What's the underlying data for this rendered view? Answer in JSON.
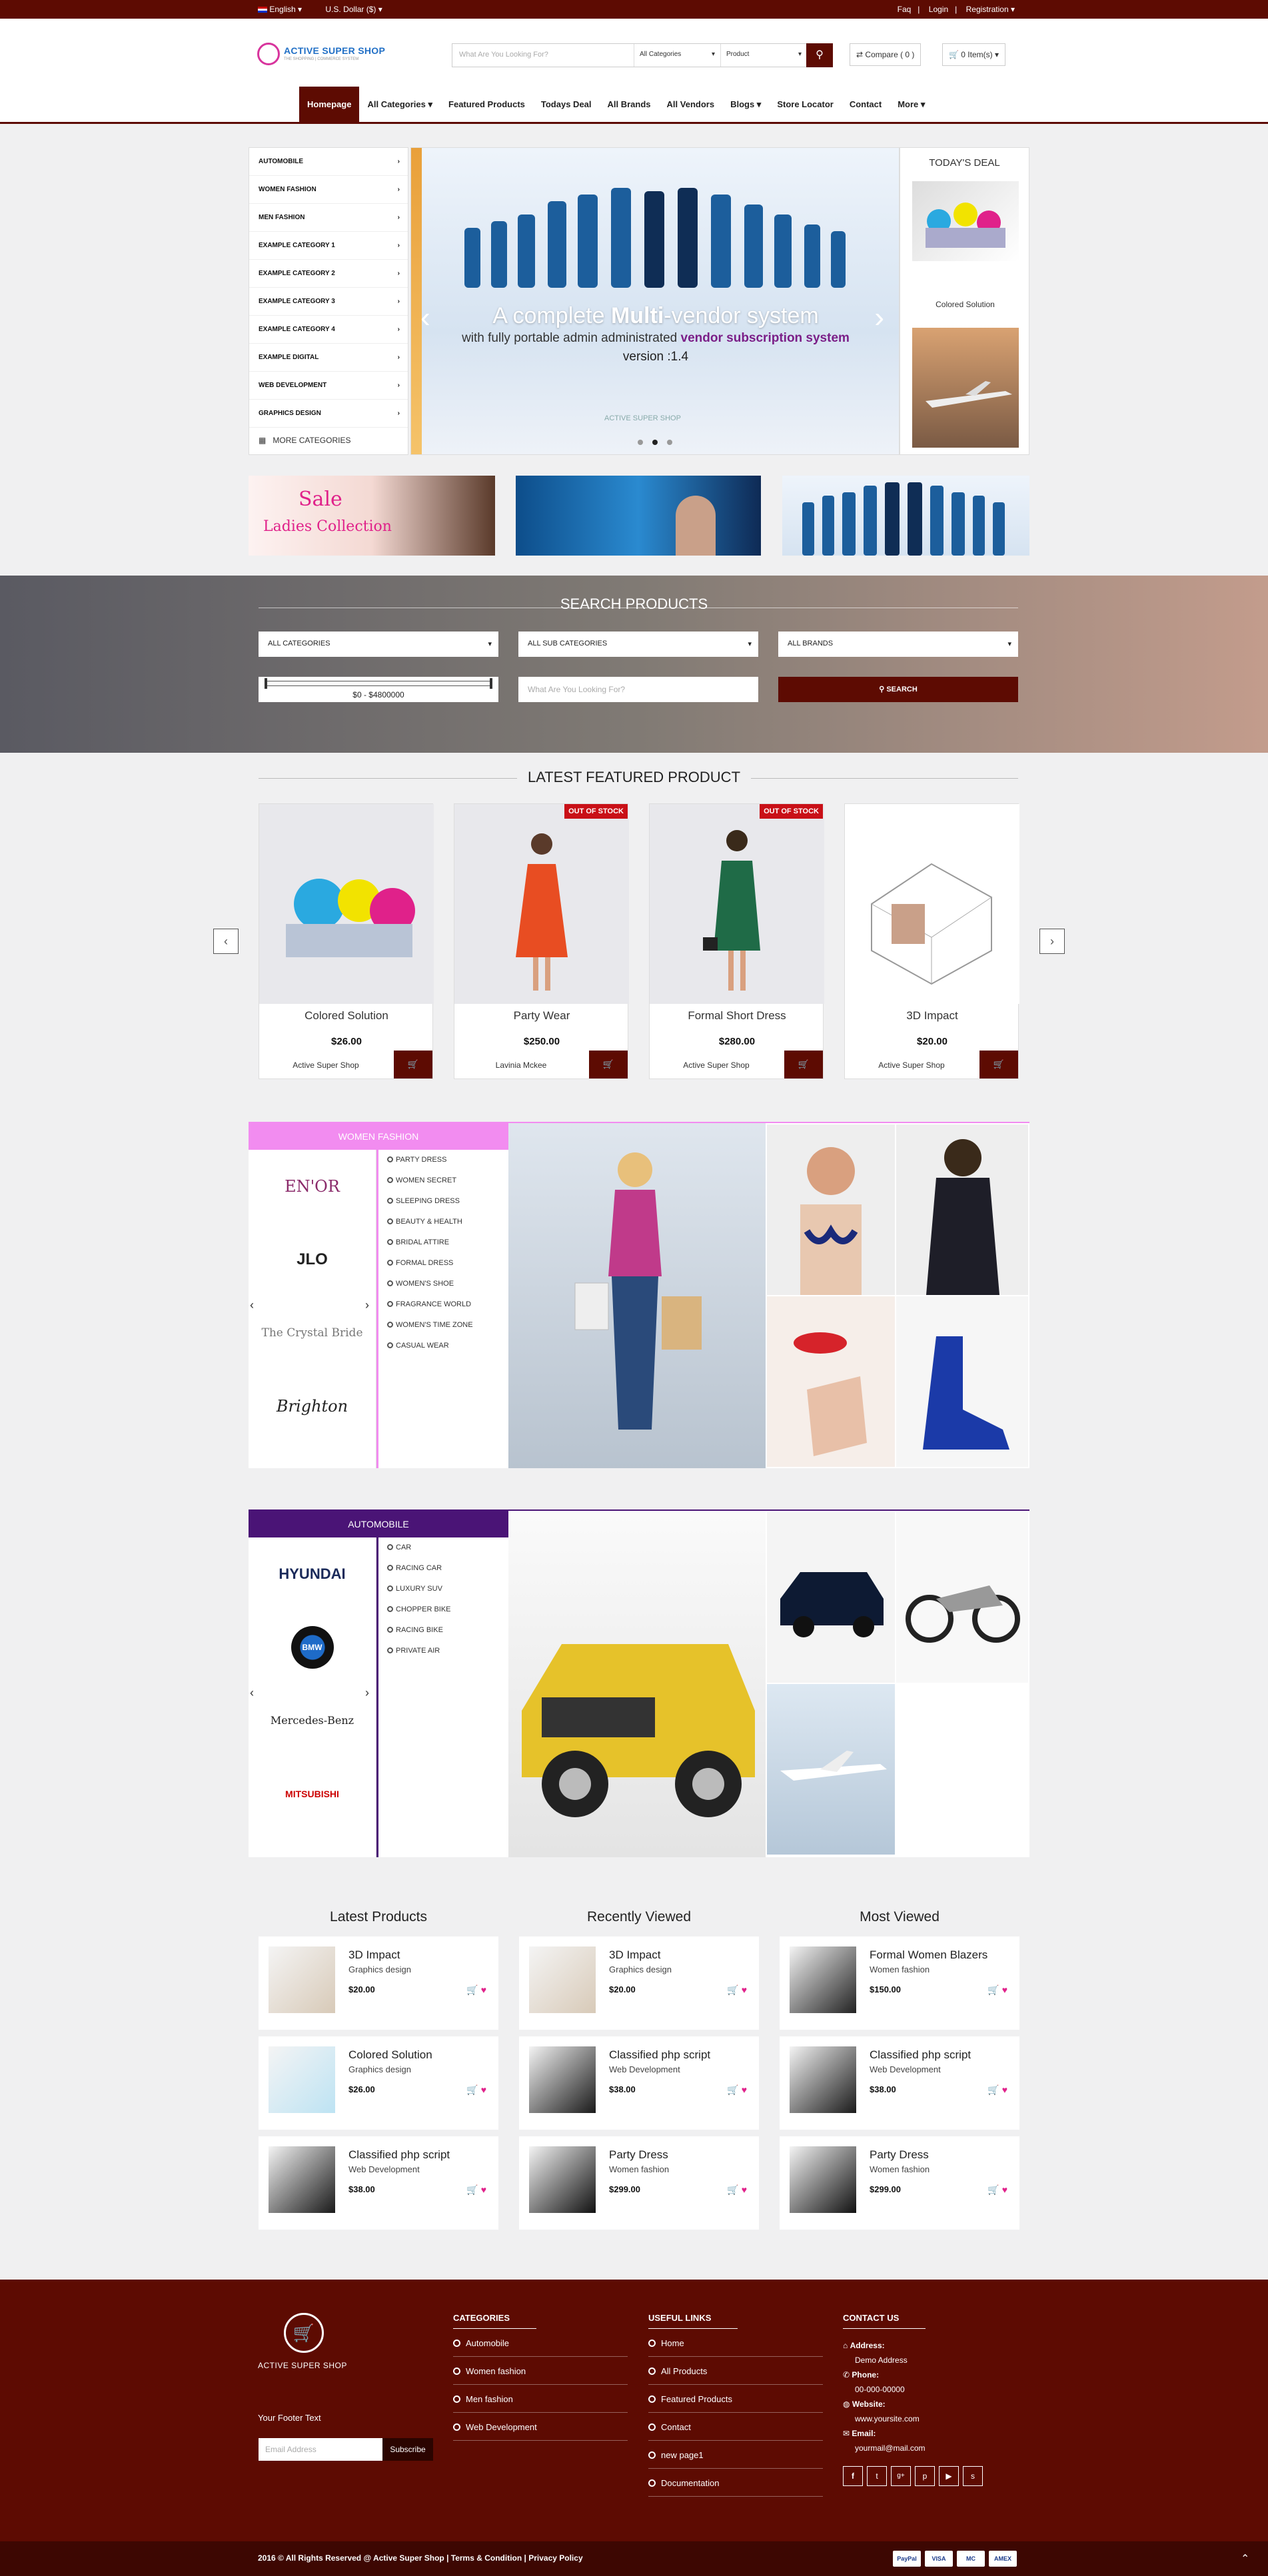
{
  "topbar": {
    "language": "English",
    "currency": "U.S. Dollar ($)",
    "faq": "Faq",
    "login": "Login",
    "registration": "Registration"
  },
  "header": {
    "logo_title": "ACTIVE SUPER SHOP",
    "logo_tagline": "THE SHOPPING | COMMERCE SYSTEM",
    "search_placeholder": "What Are You Looking For?",
    "search_category": "All Categories",
    "search_type": "Product",
    "compare": "Compare ( 0 )",
    "cart": "0 Item(s)"
  },
  "nav": [
    "Homepage",
    "All Categories",
    "Featured Products",
    "Todays Deal",
    "All Brands",
    "All Vendors",
    "Blogs",
    "Store Locator",
    "Contact",
    "More"
  ],
  "categories": [
    "AUTOMOBILE",
    "WOMEN FASHION",
    "MEN FASHION",
    "EXAMPLE CATEGORY 1",
    "EXAMPLE CATEGORY 2",
    "EXAMPLE CATEGORY 3",
    "EXAMPLE CATEGORY 4",
    "EXAMPLE DIGITAL",
    "WEB DEVELOPMENT",
    "GRAPHICS DESIGN"
  ],
  "more_categories": "MORE CATEGORIES",
  "slider": {
    "line1_a": "A complete ",
    "line1_b": "Multi",
    "line1_c": "-vendor system",
    "line2_a": "with fully portable admin administrated ",
    "line2_b": "vendor subscription system",
    "line3": "version :1.4",
    "watermark": "ACTIVE SUPER SHOP"
  },
  "todays_deal": {
    "title": "TODAY'S DEAL",
    "item": "Colored Solution"
  },
  "banners": {
    "sale_line1": "Sale",
    "sale_line2": "Ladies Collection"
  },
  "search_products": {
    "title": "SEARCH PRODUCTS",
    "all_categories": "ALL CATEGORIES",
    "all_sub_categories": "ALL SUB CATEGORIES",
    "all_brands": "ALL BRANDS",
    "price_range": "$0 - $4800000",
    "keyword_placeholder": "What Are You Looking For?",
    "button": "SEARCH"
  },
  "featured": {
    "title": "LATEST FEATURED PRODUCT",
    "out_of_stock": "OUT OF STOCK",
    "products": [
      {
        "name": "Colored Solution",
        "price": "$26.00",
        "vendor": "Active Super Shop"
      },
      {
        "name": "Party Wear",
        "price": "$250.00",
        "vendor": "Lavinia Mckee"
      },
      {
        "name": "Formal Short Dress",
        "price": "$280.00",
        "vendor": "Active Super Shop"
      },
      {
        "name": "3D Impact",
        "price": "$20.00",
        "vendor": "Active Super Shop"
      }
    ]
  },
  "women_fashion": {
    "title": "WOMEN FASHION",
    "brands": [
      "EN'OR",
      "JLO",
      "The Crystal Bride",
      "Brighton"
    ],
    "links": [
      "PARTY DRESS",
      "WOMEN SECRET",
      "SLEEPING DRESS",
      "BEAUTY & HEALTH",
      "BRIDAL ATTIRE",
      "FORMAL DRESS",
      "WOMEN'S SHOE",
      "FRAGRANCE WORLD",
      "WOMEN'S TIME ZONE",
      "CASUAL WEAR"
    ]
  },
  "automobile": {
    "title": "AUTOMOBILE",
    "brands": [
      "HYUNDAI",
      "BMW",
      "Mercedes-Benz",
      "MITSUBISHI"
    ],
    "links": [
      "CAR",
      "RACING CAR",
      "LUXURY SUV",
      "CHOPPER BIKE",
      "RACING BIKE",
      "PRIVATE AIR"
    ]
  },
  "lists": {
    "latest_title": "Latest Products",
    "recent_title": "Recently Viewed",
    "most_title": "Most Viewed",
    "latest": [
      {
        "name": "3D Impact",
        "cat": "Graphics design",
        "price": "$20.00"
      },
      {
        "name": "Colored Solution",
        "cat": "Graphics design",
        "price": "$26.00"
      },
      {
        "name": "Classified php script",
        "cat": "Web Development",
        "price": "$38.00"
      }
    ],
    "recent": [
      {
        "name": "3D Impact",
        "cat": "Graphics design",
        "price": "$20.00"
      },
      {
        "name": "Classified php script",
        "cat": "Web Development",
        "price": "$38.00"
      },
      {
        "name": "Party Dress",
        "cat": "Women fashion",
        "price": "$299.00"
      }
    ],
    "most": [
      {
        "name": "Formal Women Blazers",
        "cat": "Women fashion",
        "price": "$150.00"
      },
      {
        "name": "Classified php script",
        "cat": "Web Development",
        "price": "$38.00"
      },
      {
        "name": "Party Dress",
        "cat": "Women fashion",
        "price": "$299.00"
      }
    ]
  },
  "footer": {
    "logo_title": "ACTIVE SUPER SHOP",
    "footer_text": "Your Footer Text",
    "email_placeholder": "Email Address",
    "subscribe": "Subscribe",
    "categories_title": "CATEGORIES",
    "categories": [
      "Automobile",
      "Women fashion",
      "Men fashion",
      "Web Development"
    ],
    "useful_title": "USEFUL LINKS",
    "useful": [
      "Home",
      "All Products",
      "Featured Products",
      "Contact",
      "new page1",
      "Documentation"
    ],
    "contact_title": "CONTACT US",
    "address_label": "Address:",
    "address": "Demo Address",
    "phone_label": "Phone:",
    "phone": "00-000-00000",
    "website_label": "Website:",
    "website": "www.yoursite.com",
    "email_label": "Email:",
    "email": "yourmail@mail.com",
    "copyright": "2016 © All Rights Reserved @ Active Super Shop | Terms & Condition | Privacy Policy",
    "payments": [
      "PayPal",
      "VISA",
      "MC",
      "AMEX"
    ]
  }
}
